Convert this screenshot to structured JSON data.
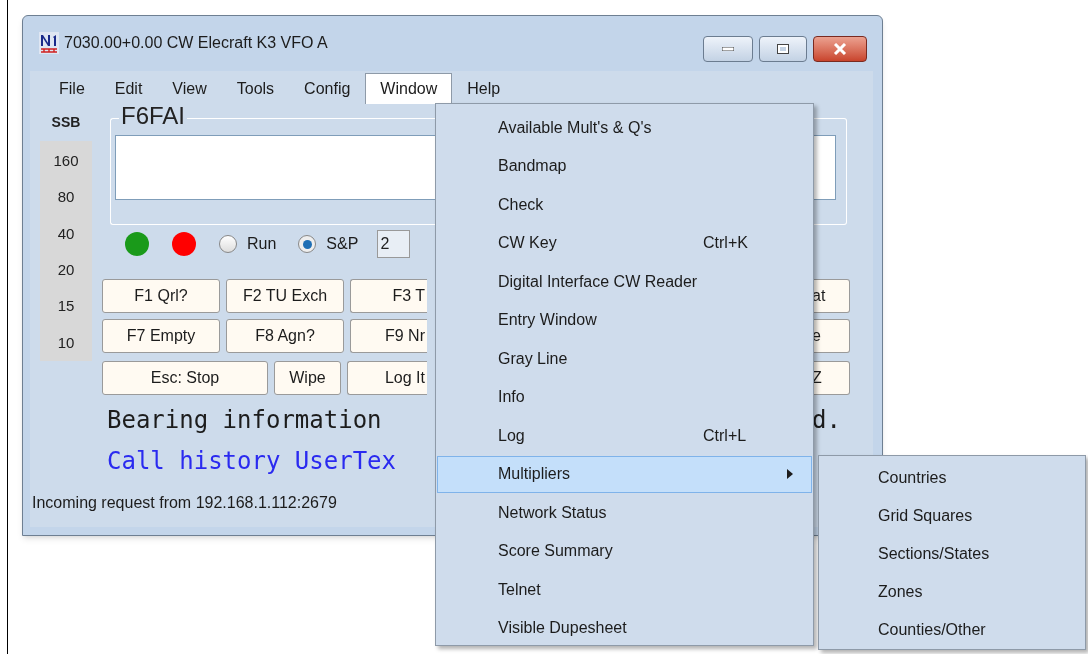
{
  "window": {
    "title": "7030.00+0.00 CW Elecraft K3 VFO A"
  },
  "menu_bar": [
    {
      "label": "File",
      "selected": false
    },
    {
      "label": "Edit",
      "selected": false
    },
    {
      "label": "View",
      "selected": false
    },
    {
      "label": "Tools",
      "selected": false
    },
    {
      "label": "Config",
      "selected": false
    },
    {
      "label": "Window",
      "selected": true
    },
    {
      "label": "Help",
      "selected": false
    }
  ],
  "band_panel": {
    "mode": "SSB",
    "bands": [
      "160",
      "80",
      "40",
      "20",
      "15",
      "10"
    ]
  },
  "entry": {
    "call": "F6FAI"
  },
  "indicators": [
    {
      "color": "#1a9a1a"
    },
    {
      "color": "#ff0000"
    }
  ],
  "radios": [
    {
      "label": "Run",
      "selected": false
    },
    {
      "label": "S&P",
      "selected": true
    }
  ],
  "combo_value": "2",
  "function_key_rows": [
    {
      "left": [
        "F1 Qrl?",
        "F2 TU Exch",
        "F3 T"
      ],
      "right": "at"
    },
    {
      "left": [
        "F7 Empty",
        "F8 Agn?",
        "F9 Nr"
      ],
      "right": "e"
    },
    {
      "left": [
        "Esc: Stop",
        "Wipe",
        "Log It"
      ],
      "right": "Z"
    }
  ],
  "messages": [
    {
      "kind": "info",
      "left": "Bearing information",
      "right": "d."
    },
    {
      "kind": "history",
      "left": "Call history UserTex"
    }
  ],
  "status_bar": "Incoming request from 192.168.1.112:2679",
  "dropdown_menu": [
    {
      "label": "Available Mult's & Q's",
      "selected": false
    },
    {
      "label": "Bandmap",
      "selected": false
    },
    {
      "label": "Check",
      "selected": false
    },
    {
      "label": "CW Key",
      "shortcut": "Ctrl+K",
      "selected": false
    },
    {
      "label": "Digital Interface CW Reader",
      "selected": false
    },
    {
      "label": "Entry Window",
      "selected": false
    },
    {
      "label": "Gray Line",
      "selected": false
    },
    {
      "label": "Info",
      "selected": false
    },
    {
      "label": "Log",
      "shortcut": "Ctrl+L",
      "selected": false
    },
    {
      "label": "Multipliers",
      "submenu": true,
      "selected": true
    },
    {
      "label": "Network Status",
      "selected": false
    },
    {
      "label": "Score Summary",
      "selected": false
    },
    {
      "label": "Telnet",
      "selected": false
    },
    {
      "label": "Visible Dupesheet",
      "selected": false
    }
  ],
  "submenu": [
    "Countries",
    "Grid Squares",
    "Sections/States",
    "Zones",
    "Counties/Other"
  ]
}
